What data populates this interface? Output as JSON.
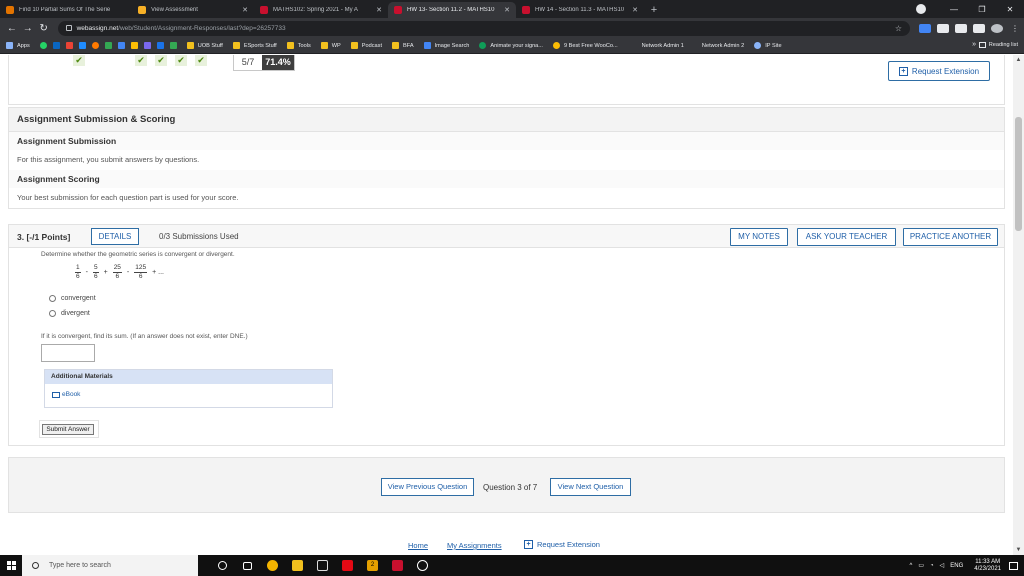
{
  "browser": {
    "tabs": [
      {
        "title": "Find 10 Partial Sums Of The Serie",
        "color": "#e37400",
        "active": false
      },
      {
        "title": "View Assessment",
        "color": "#f6b026",
        "active": false
      },
      {
        "title": "MATHS102: Spring 2021 - My A",
        "color": "#c8102e",
        "active": false
      },
      {
        "title": "HW 13- Section 11.2 - MATHS10",
        "color": "#c8102e",
        "active": true
      },
      {
        "title": "HW 14 - Section 11.3 - MATHS10",
        "color": "#c8102e",
        "active": false
      }
    ],
    "url_host": "webassign.net",
    "url_path": "/web/Student/Assignment-Responses/last?dep=26257733",
    "bookmarks": [
      {
        "label": "Apps",
        "color": "#8ab4f8"
      },
      {
        "label": "UOB Stuff",
        "color": "#f2c01e"
      },
      {
        "label": "ESports Stuff",
        "color": "#f2c01e"
      },
      {
        "label": "Tools",
        "color": "#f2c01e"
      },
      {
        "label": "WP",
        "color": "#f2c01e"
      },
      {
        "label": "Podcast",
        "color": "#f2c01e"
      },
      {
        "label": "BFA",
        "color": "#f2c01e"
      },
      {
        "label": "Image Search",
        "color": "#4285f4"
      },
      {
        "label": "Animate your signa...",
        "color": "#0f9d58"
      },
      {
        "label": "9 Best Free WooCo...",
        "color": "#fbbc04"
      },
      {
        "label": "Network Admin 1",
        "color": "#35363a"
      },
      {
        "label": "Network Admin 2",
        "color": "#35363a"
      },
      {
        "label": "IP Site",
        "color": "#8ab4f8"
      }
    ],
    "bookmarks_more": "»",
    "reading_list": "Reading list"
  },
  "score": {
    "fraction": "5/7",
    "percent": "71.4%",
    "request_extension": "Request Extension"
  },
  "submission": {
    "title": "Assignment Submission & Scoring",
    "sub_head": "Assignment Submission",
    "sub_text": "For this assignment, you submit answers by questions.",
    "scoring_head": "Assignment Scoring",
    "scoring_text": "Your best submission for each question part is used for your score."
  },
  "question": {
    "number": "3.  [-/1 Points]",
    "details": "DETAILS",
    "submissions_used": "0/3 Submissions Used",
    "my_notes": "MY NOTES",
    "ask_teacher": "ASK YOUR TEACHER",
    "practice_another": "PRACTICE ANOTHER",
    "prompt": "Determine whether the geometric series is convergent or divergent.",
    "series": {
      "t1_num": "1",
      "t1_den": "6",
      "op1": "-",
      "t2_num": "5",
      "t2_den": "6",
      "op2": "+",
      "t3_num": "25",
      "t3_den": "6",
      "op3": "-",
      "t4_num": "125",
      "t4_den": "6",
      "op4": "+ ..."
    },
    "option_convergent": "convergent",
    "option_divergent": "divergent",
    "sum_prompt": "If it is convergent, find its sum. (If an answer does not exist, enter DNE.)",
    "materials_head": "Additional Materials",
    "ebook": "eBook",
    "submit": "Submit Answer"
  },
  "navigation": {
    "prev": "View Previous Question",
    "position": "Question 3 of 7",
    "next": "View Next Question"
  },
  "footer": {
    "home": "Home",
    "my_assignments": "My Assignments",
    "request_extension": "Request Extension"
  },
  "taskbar": {
    "search_placeholder": "Type here to search",
    "lang": "ENG",
    "time": "11:33 AM",
    "date": "4/23/2021",
    "notif_count": "2"
  }
}
